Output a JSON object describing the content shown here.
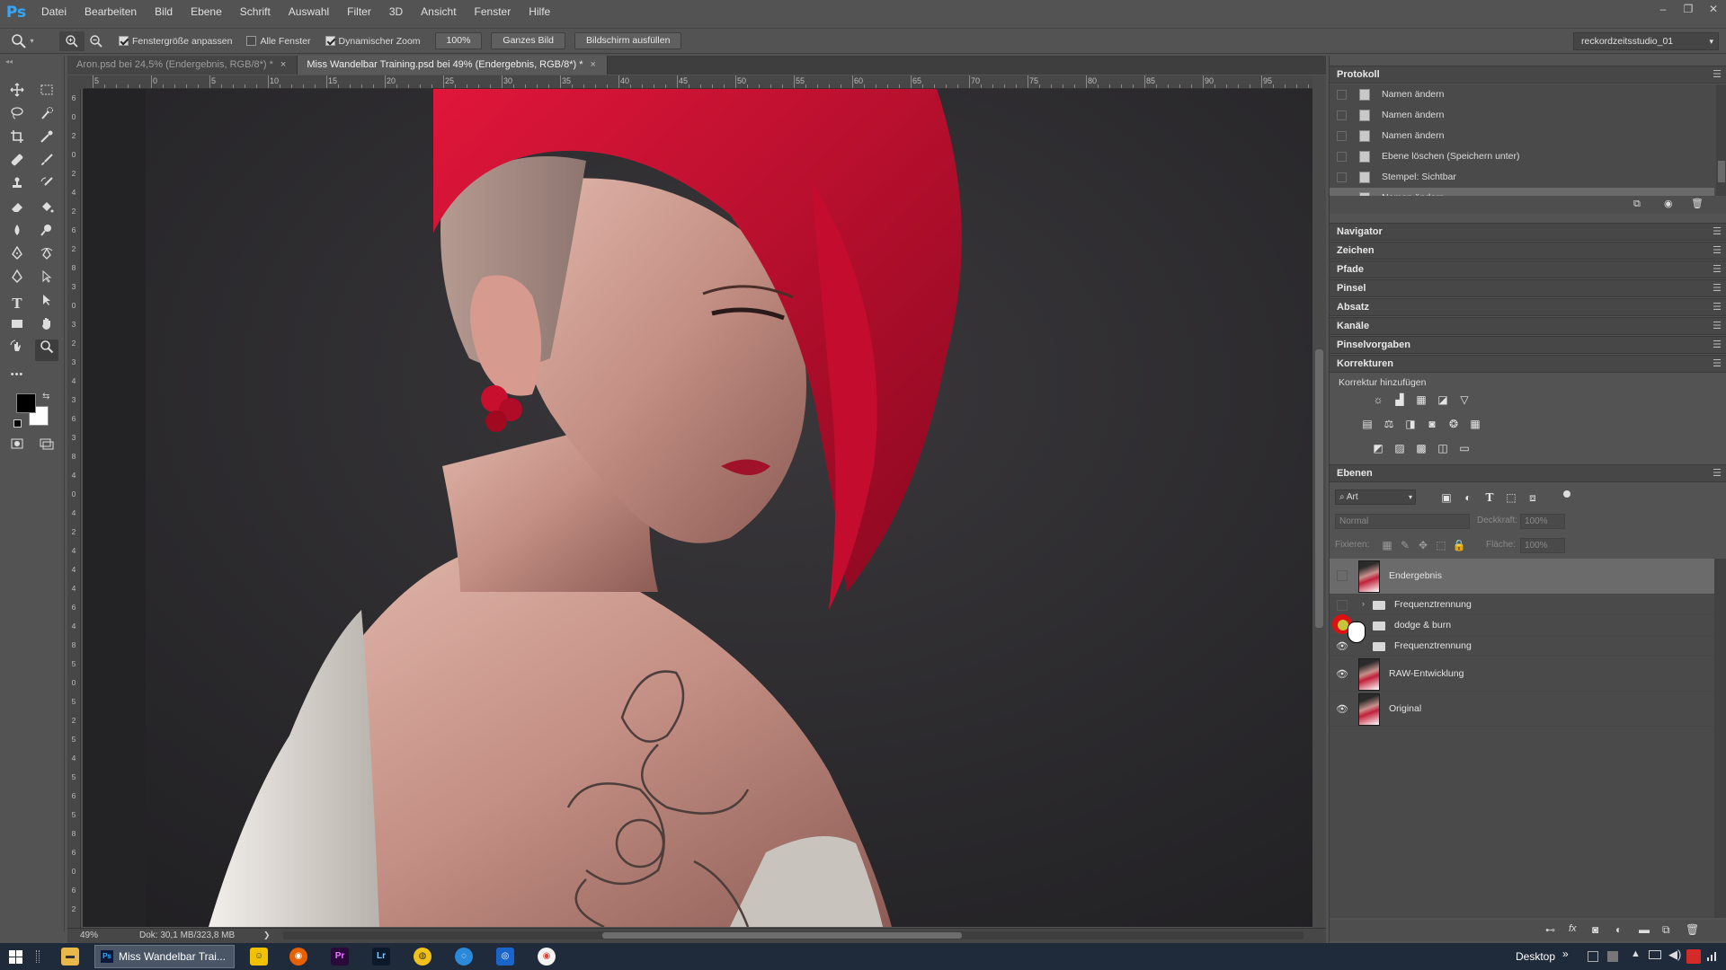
{
  "app": {
    "logo": "Ps"
  },
  "menu": [
    "Datei",
    "Bearbeiten",
    "Bild",
    "Ebene",
    "Schrift",
    "Auswahl",
    "Filter",
    "3D",
    "Ansicht",
    "Fenster",
    "Hilfe"
  ],
  "window_controls": {
    "minimize": "–",
    "restore": "❐",
    "close": "✕"
  },
  "options": {
    "fit_window": "Fenstergröße anpassen",
    "all_windows": "Alle Fenster",
    "dynamic_zoom": "Dynamischer Zoom",
    "btn_100": "100%",
    "btn_whole": "Ganzes Bild",
    "btn_fill": "Bildschirm ausfüllen",
    "workspace": "reckordzeitsstudio_01"
  },
  "tabs": [
    {
      "label": "Aron.psd bei 24,5% (Endergebnis, RGB/8*) *",
      "close": "×"
    },
    {
      "label": "Miss Wandelbar Training.psd bei 49% (Endergebnis, RGB/8*) *",
      "close": "×"
    }
  ],
  "ruler_h": [
    "5",
    "0",
    "5",
    "10",
    "15",
    "20",
    "25",
    "30",
    "35",
    "40",
    "45",
    "50",
    "55",
    "60",
    "65",
    "70",
    "75",
    "80",
    "85",
    "90",
    "95"
  ],
  "ruler_v": [
    "6",
    "0",
    "2",
    "0",
    "2",
    "4",
    "2",
    "6",
    "2",
    "8",
    "3",
    "0",
    "3",
    "2",
    "3",
    "4",
    "3",
    "6",
    "3",
    "8",
    "4",
    "0",
    "4",
    "2",
    "4",
    "4",
    "4",
    "6",
    "4",
    "8",
    "5",
    "0",
    "5",
    "2",
    "5",
    "4",
    "5",
    "6",
    "5",
    "8",
    "6",
    "0",
    "6",
    "2"
  ],
  "status": {
    "zoom": "49%",
    "doc": "Dok: 30,1 MB/323,8 MB",
    "arrow": "❯"
  },
  "panels": {
    "history": {
      "title": "Protokoll",
      "items": [
        "Namen ändern",
        "Namen ändern",
        "Namen ändern",
        "Ebene löschen (Speichern unter)",
        "Stempel: Sichtbar",
        "Namen ändern"
      ]
    },
    "collapsed": [
      "Navigator",
      "Zeichen",
      "Pfade",
      "Pinsel",
      "Absatz",
      "Kanäle",
      "Pinselvorgaben"
    ],
    "corrections": {
      "title": "Korrekturen",
      "subtitle": "Korrektur hinzufügen"
    },
    "layers": {
      "title": "Ebenen",
      "filter": "Art",
      "blend": "Normal",
      "opacity_label": "Deckkraft:",
      "opacity_value": "100%",
      "lock_label": "Fixieren:",
      "fill_label": "Fläche:",
      "fill_value": "100%",
      "items": [
        {
          "name": "Endergebnis",
          "type": "image",
          "visible": false
        },
        {
          "name": "Frequenztrennung",
          "type": "group",
          "visible": false
        },
        {
          "name": "dodge & burn",
          "type": "group",
          "visible": true
        },
        {
          "name": "Frequenztrennung",
          "type": "group",
          "visible": true
        },
        {
          "name": "RAW-Entwicklung",
          "type": "image",
          "visible": true
        },
        {
          "name": "Original",
          "type": "image",
          "visible": true
        }
      ]
    }
  },
  "taskbar": {
    "active_task": "Miss Wandelbar Trai...",
    "desktop": "Desktop",
    "chevron": "»"
  },
  "colors": {
    "accent": "#31a8ff",
    "panel": "#535353",
    "dark": "#3e3e3e"
  }
}
